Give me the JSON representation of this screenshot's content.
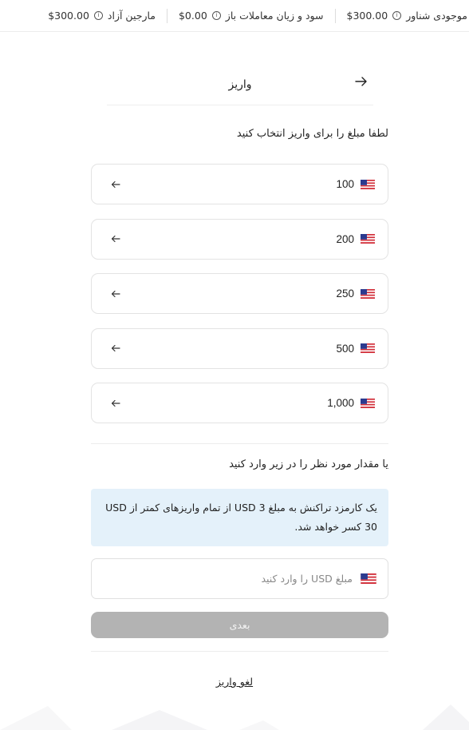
{
  "topbar": {
    "stats": [
      {
        "label": "موجودی شناور",
        "value": "$300.00"
      },
      {
        "label": "سود و زیان معاملات باز",
        "value": "$0.00"
      },
      {
        "label": "مارجین آزاد",
        "value": "$300.00"
      }
    ],
    "info_icon": "info-icon"
  },
  "header": {
    "title": "واریز",
    "back_icon": "arrow-right-icon"
  },
  "prompt": "لطفا مبلغ را برای واریز انتخاب کنید",
  "amounts": [
    {
      "value": "100",
      "flag": "us-flag-icon",
      "arrow": "arrow-left-icon"
    },
    {
      "value": "200",
      "flag": "us-flag-icon",
      "arrow": "arrow-left-icon"
    },
    {
      "value": "250",
      "flag": "us-flag-icon",
      "arrow": "arrow-left-icon"
    },
    {
      "value": "500",
      "flag": "us-flag-icon",
      "arrow": "arrow-left-icon"
    },
    {
      "value": "1,000",
      "flag": "us-flag-icon",
      "arrow": "arrow-left-icon"
    }
  ],
  "custom_prompt": "یا مقدار مورد نظر را در زیر وارد کنید",
  "fee_note": "یک کارمزد تراکنش به مبلغ USD 3 از تمام واریزهای کمتر از USD 30 کسر خواهد شد.",
  "amount_input": {
    "placeholder": "مبلغ USD را وارد کنید",
    "value": ""
  },
  "next_button": "بعدی",
  "cancel_link": "لغو واریز",
  "colors": {
    "info_bg": "#e4f1fa",
    "button_disabled": "#b3b3b3",
    "border": "#e3e3e3"
  }
}
